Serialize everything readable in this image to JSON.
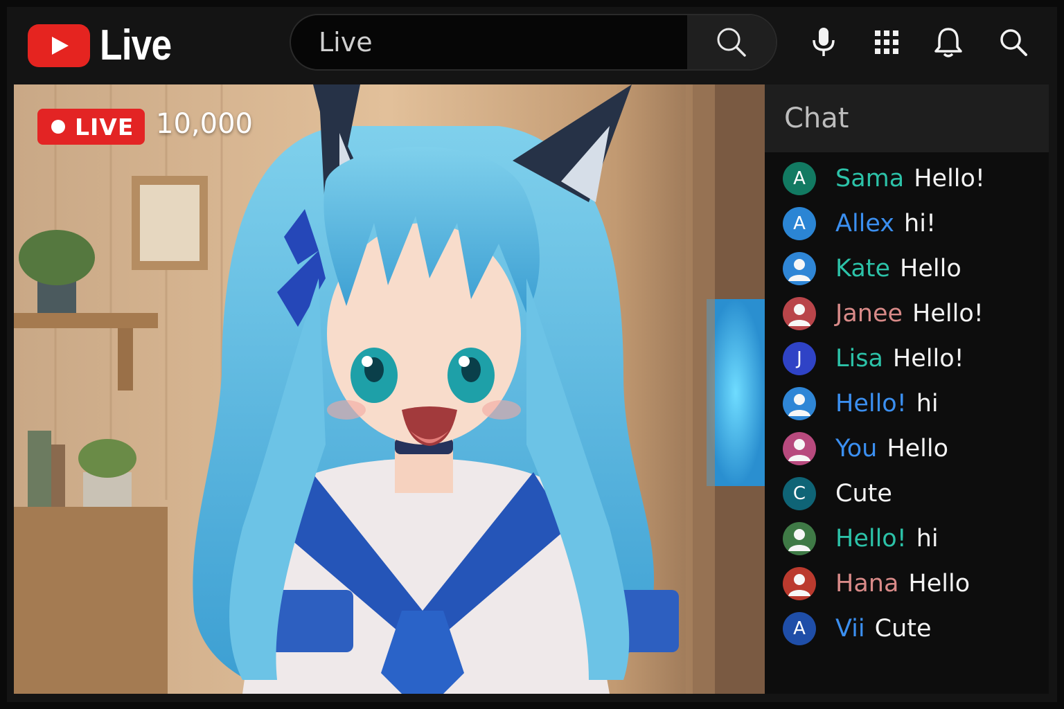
{
  "app": {
    "logo_text": "Live"
  },
  "search": {
    "value": "Live"
  },
  "toolbar_icons": [
    "mic-icon",
    "apps-grid-icon",
    "bell-icon",
    "search-icon"
  ],
  "stream": {
    "live_label": "LIVE",
    "viewer_count": "10,000"
  },
  "chat": {
    "title": "Chat",
    "messages": [
      {
        "avatar": "A",
        "avatar_color": "#127a62",
        "name": "Sama",
        "name_color": "#2cc2a8",
        "text": "Hello!"
      },
      {
        "avatar": "A",
        "avatar_color": "#2b85d4",
        "name": "Allex",
        "name_color": "#3b8ff0",
        "text": "hi!"
      },
      {
        "avatar": "person-icon",
        "avatar_color": "#2f86d6",
        "name": "Kate",
        "name_color": "#2cc2a8",
        "text": "Hello"
      },
      {
        "avatar": "person-icon",
        "avatar_color": "#b9454a",
        "name": "Janee",
        "name_color": "#d88a88",
        "text": "Hello!"
      },
      {
        "avatar": "J",
        "avatar_color": "#2f43c6",
        "name": "Lisa",
        "name_color": "#2cc2a8",
        "text": "Hello!"
      },
      {
        "avatar": "person-icon",
        "avatar_color": "#2f86d6",
        "name": "Hello!",
        "name_color": "#3b8ff0",
        "text": "hi"
      },
      {
        "avatar": "person-icon",
        "avatar_color": "#b84a7e",
        "name": "You",
        "name_color": "#3b8ff0",
        "text": "Hello"
      },
      {
        "avatar": "C",
        "avatar_color": "#0f6476",
        "name": "",
        "name_color": "#2cc2a8",
        "text": "Cute"
      },
      {
        "avatar": "person-icon",
        "avatar_color": "#3f7a46",
        "name": "Hello!",
        "name_color": "#2cc2a8",
        "text": "hi"
      },
      {
        "avatar": "person-icon",
        "avatar_color": "#bb3a2e",
        "name": "Hana",
        "name_color": "#d88a88",
        "text": "Hello"
      },
      {
        "avatar": "A",
        "avatar_color": "#1f4ea8",
        "name": "Vii",
        "name_color": "#3b8ff0",
        "text": "Cute"
      }
    ]
  }
}
